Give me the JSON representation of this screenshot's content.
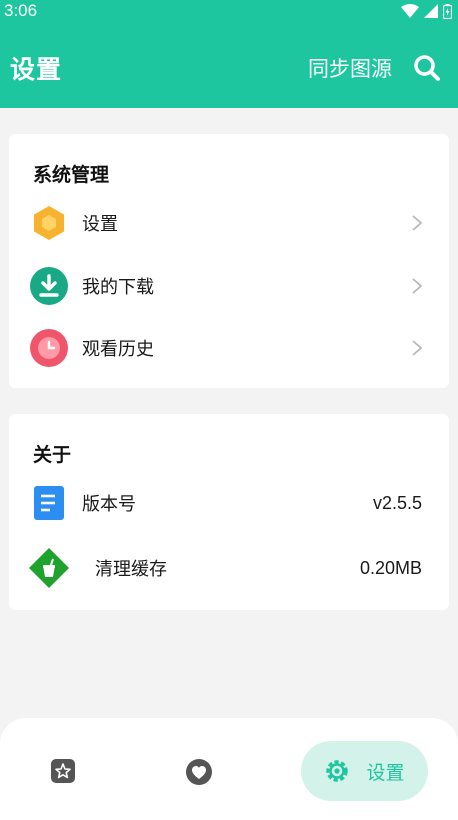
{
  "status": {
    "time": "3:06"
  },
  "appbar": {
    "title": "设置",
    "sync_label": "同步图源"
  },
  "system": {
    "title": "系统管理",
    "items": [
      {
        "label": "设置",
        "icon": "hexagon-settings-icon"
      },
      {
        "label": "我的下载",
        "icon": "download-icon"
      },
      {
        "label": "观看历史",
        "icon": "clock-history-icon"
      }
    ]
  },
  "about": {
    "title": "关于",
    "items": [
      {
        "label": "版本号",
        "value": "v2.5.5",
        "icon": "document-icon"
      },
      {
        "label": "清理缓存",
        "value": "0.20MB",
        "icon": "broom-icon"
      }
    ]
  },
  "bottom_nav": {
    "active_label": "设置"
  },
  "colors": {
    "accent": "#1ec6a0",
    "active_pill": "#d3f3ea"
  }
}
